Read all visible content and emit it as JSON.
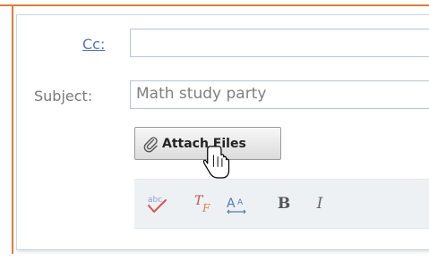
{
  "compose": {
    "cc_label": "Cc:",
    "cc_value": "",
    "subject_label": "Subject:",
    "subject_value": "Math study party",
    "attach_label": "Attach Files"
  },
  "icons": {
    "attach": "paperclip-icon",
    "spellcheck": "spellcheck-icon",
    "font": "font-icon",
    "font_size": "font-size-icon",
    "bold": "bold-icon",
    "italic": "italic-icon",
    "cursor": "hand-pointer-cursor"
  },
  "toolbar": {
    "bold_glyph": "B",
    "italic_glyph": "I"
  },
  "colors": {
    "accent_line": "#e07b3a",
    "link": "#5a73b8",
    "label": "#7a7a7a"
  }
}
